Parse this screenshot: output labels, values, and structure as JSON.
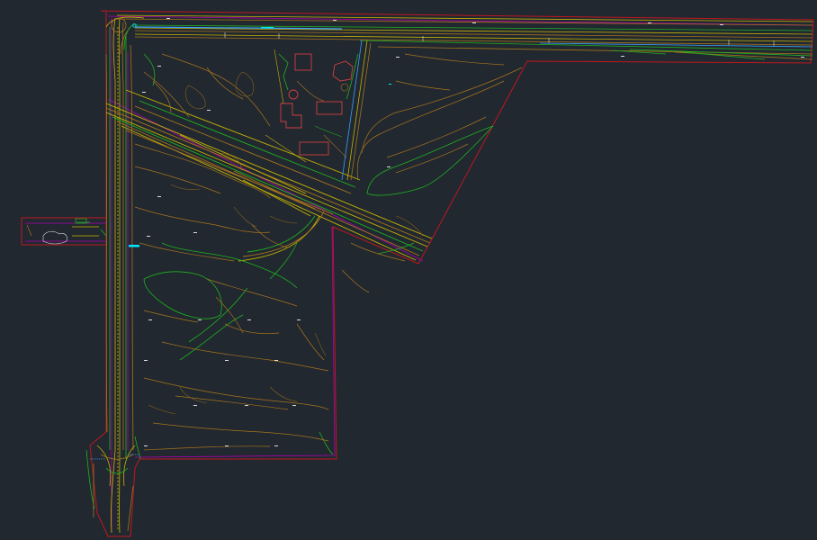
{
  "drawing": {
    "colors": {
      "background": "#212830",
      "boundary": "#c0171f",
      "contour_major": "#a8741c",
      "contour_minor": "#8c6418",
      "green_line": "#1fb31f",
      "edge_of_pavement": "#c8b400",
      "right_of_way": "#b000b0",
      "utility": "#3aa0ff",
      "cyan": "#00e5ff",
      "building": "#d04040",
      "white_text": "#dcdcdc"
    },
    "spot_labels": [
      "",
      "",
      "",
      "",
      "",
      "",
      "",
      "",
      "",
      "",
      "",
      "",
      "",
      "",
      "",
      "",
      "",
      "",
      "",
      "",
      "",
      "",
      "",
      "",
      "",
      "",
      "",
      "",
      ""
    ],
    "road_label": ""
  }
}
